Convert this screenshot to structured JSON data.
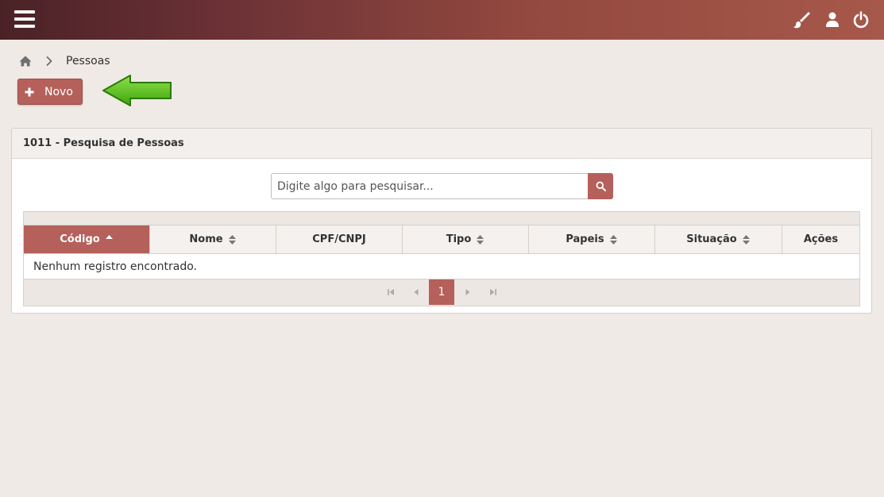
{
  "topbar": {
    "menu_icon": "hamburger-menu-icon",
    "icons": [
      "paintbrush-icon",
      "user-icon",
      "power-icon"
    ]
  },
  "breadcrumb": {
    "home_icon": "home-icon",
    "separator_icon": "chevron-right-icon",
    "current": "Pessoas"
  },
  "actions": {
    "new_label": "Novo",
    "new_icon": "plus-icon"
  },
  "panel": {
    "title": "1011 - Pesquisa de Pessoas"
  },
  "search": {
    "placeholder": "Digite algo para pesquisar...",
    "value": "",
    "button_icon": "search-icon"
  },
  "table": {
    "columns": [
      "Código",
      "Nome",
      "CPF/CNPJ",
      "Tipo",
      "Papeis",
      "Situação",
      "Ações"
    ],
    "sorted_column": "Código",
    "empty_message": "Nenhum registro encontrado."
  },
  "pagination": {
    "current_page": "1"
  },
  "colors": {
    "accent": "#b5605a",
    "topbar_dark": "#4a2226",
    "topbar_light": "#a6584a",
    "background": "#efeae5",
    "arrow_green": "#5cc21a"
  }
}
